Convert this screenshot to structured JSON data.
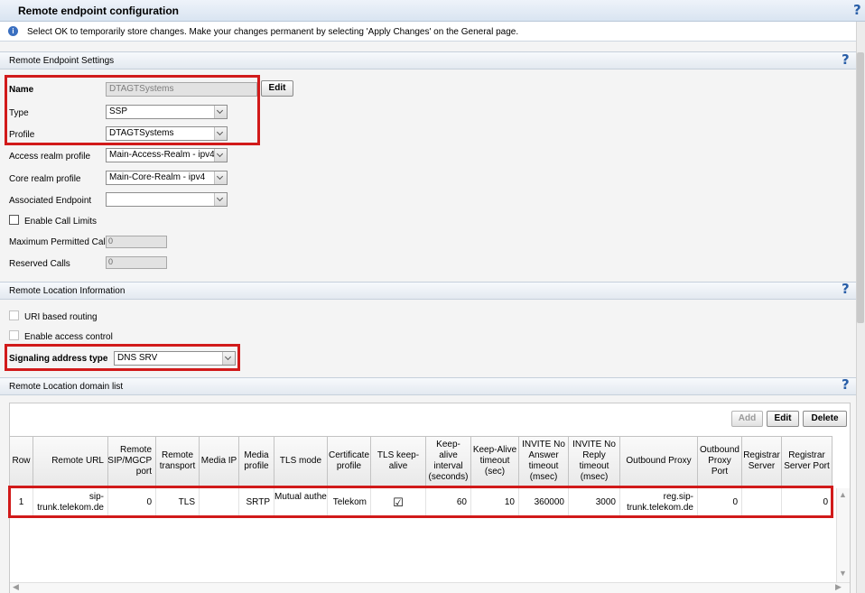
{
  "window": {
    "title": "Remote endpoint configuration",
    "help": "?"
  },
  "info": {
    "text": "Select OK to temporarily store changes. Make your changes permanent by selecting 'Apply Changes' on the General page."
  },
  "settings": {
    "section_title": "Remote Endpoint Settings",
    "name_label": "Name",
    "name_value": "DTAGTSystems",
    "edit_label": "Edit",
    "type_label": "Type",
    "type_value": "SSP",
    "profile_label": "Profile",
    "profile_value": "DTAGTSystems",
    "access_realm_label": "Access realm profile",
    "access_realm_value": "Main-Access-Realm - ipv4",
    "core_realm_label": "Core realm profile",
    "core_realm_value": "Main-Core-Realm - ipv4",
    "assoc_endpoint_label": "Associated Endpoint",
    "assoc_endpoint_value": "",
    "call_limits_label": "Enable Call Limits",
    "max_calls_label": "Maximum Permitted Calls",
    "max_calls_value": "0",
    "reserved_calls_label": "Reserved Calls",
    "reserved_calls_value": "0"
  },
  "location": {
    "section_title": "Remote Location Information",
    "uri_routing_label": "URI based routing",
    "access_control_label": "Enable access control",
    "signaling_label": "Signaling address type",
    "signaling_value": "DNS SRV"
  },
  "domain_list": {
    "section_title": "Remote Location domain list",
    "add_label": "Add",
    "edit_label": "Edit",
    "delete_label": "Delete",
    "columns": [
      "Row",
      "Remote URL",
      "Remote SIP/MGCP port",
      "Remote transport",
      "Media IP",
      "Media profile",
      "TLS mode",
      "Certificate profile",
      "TLS keep-alive",
      "Keep-alive interval (seconds)",
      "Keep-Alive timeout (sec)",
      "INVITE No Answer timeout (msec)",
      "INVITE No Reply timeout (msec)",
      "Outbound Proxy",
      "Outbound Proxy Port",
      "Registrar Server",
      "Registrar Server Port"
    ],
    "rows": [
      {
        "row": "1",
        "remote_url": "sip-trunk.telekom.de",
        "port": "0",
        "transport": "TLS",
        "media_ip": "",
        "media_profile": "SRTP",
        "tls_mode": "Mutual authentication",
        "cert_profile": "Telekom",
        "tls_keepalive": "☑",
        "keepalive_interval": "60",
        "keepalive_timeout": "10",
        "invite_no_answer": "360000",
        "invite_no_reply": "3000",
        "outbound_proxy": "reg.sip-trunk.telekom.de",
        "outbound_proxy_port": "0",
        "registrar_server": "",
        "registrar_port": "0"
      }
    ]
  }
}
